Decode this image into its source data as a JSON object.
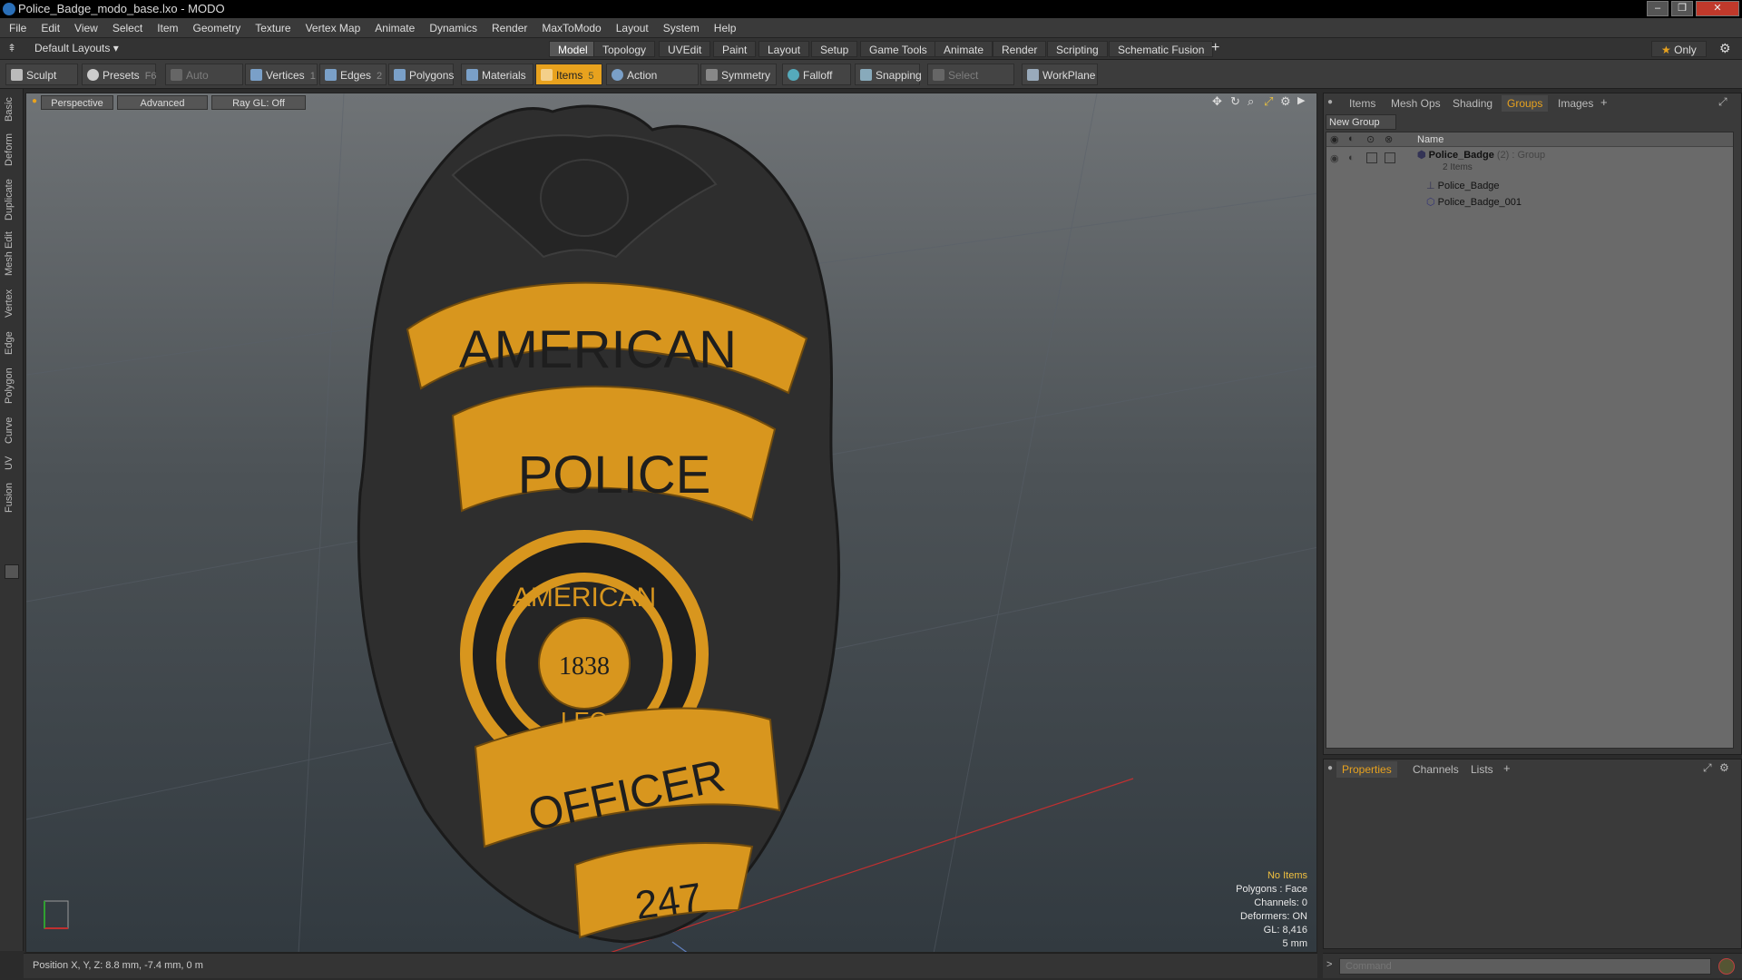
{
  "window": {
    "title": "Police_Badge_modo_base.lxo - MODO"
  },
  "menu": [
    "File",
    "Edit",
    "View",
    "Select",
    "Item",
    "Geometry",
    "Texture",
    "Vertex Map",
    "Animate",
    "Dynamics",
    "Render",
    "MaxToModo",
    "Layout",
    "System",
    "Help"
  ],
  "layoutbar": {
    "layout_label": "Default Layouts",
    "tabs": [
      "Model",
      "Topology",
      "UVEdit",
      "Paint",
      "Layout",
      "Setup",
      "Game Tools",
      "Animate",
      "Render",
      "Scripting",
      "Schematic Fusion"
    ],
    "active_tab": "Model",
    "only_label": "Only"
  },
  "toolbar": {
    "sculpt": "Sculpt",
    "presets": "Presets",
    "presets_shortcut": "F6",
    "auto_select": "Auto Select",
    "vertices": "Vertices",
    "vertices_count": "1",
    "edges": "Edges",
    "edges_count": "2",
    "polygons": "Polygons",
    "materials": "Materials",
    "items": "Items",
    "items_count": "5",
    "action_center": "Action Center",
    "symmetry": "Symmetry",
    "falloff": "Falloff",
    "snapping": "Snapping",
    "select_through": "Select Through",
    "workplane": "WorkPlane"
  },
  "left_tabs": [
    "Basic",
    "Deform",
    "Duplicate",
    "Mesh Edit",
    "Vertex",
    "Edge",
    "Polygon",
    "Curve",
    "UV",
    "Fusion"
  ],
  "viewport": {
    "view_mode": "Perspective",
    "shading": "Advanced",
    "raygl": "Ray GL: Off",
    "badge_text": {
      "top": "AMERICAN",
      "middle": "POLICE",
      "seal_top": "AMERICAN",
      "seal_year": "1838",
      "seal_bottom": "LEO",
      "bottom": "OFFICER",
      "number": "247"
    },
    "hud": {
      "no_items": "No Items",
      "polygons": "Polygons : Face",
      "channels": "Channels: 0",
      "deformers": "Deformers: ON",
      "gl": "GL: 8,416",
      "scale": "5 mm"
    }
  },
  "right_panel": {
    "tabs": [
      "Items",
      "Mesh Ops",
      "Shading",
      "Groups",
      "Images"
    ],
    "active_tab": "Groups",
    "new_group": "New Group",
    "column_name": "Name",
    "group": {
      "name": "Police_Badge",
      "count": "(2)",
      "type": ": Group",
      "subtitle": "2 Items"
    },
    "children": [
      "Police_Badge",
      "Police_Badge_001"
    ]
  },
  "bottom_panel": {
    "tabs": [
      "Properties",
      "Channels",
      "Lists"
    ],
    "active_tab": "Properties"
  },
  "status": {
    "position": "Position X, Y, Z:  8.8 mm, -7.4 mm, 0 m"
  },
  "command": {
    "placeholder": "Command"
  },
  "colors": {
    "accent": "#e8a21e",
    "badge_gold": "#d8961e",
    "badge_dark": "#2e2e2e"
  }
}
